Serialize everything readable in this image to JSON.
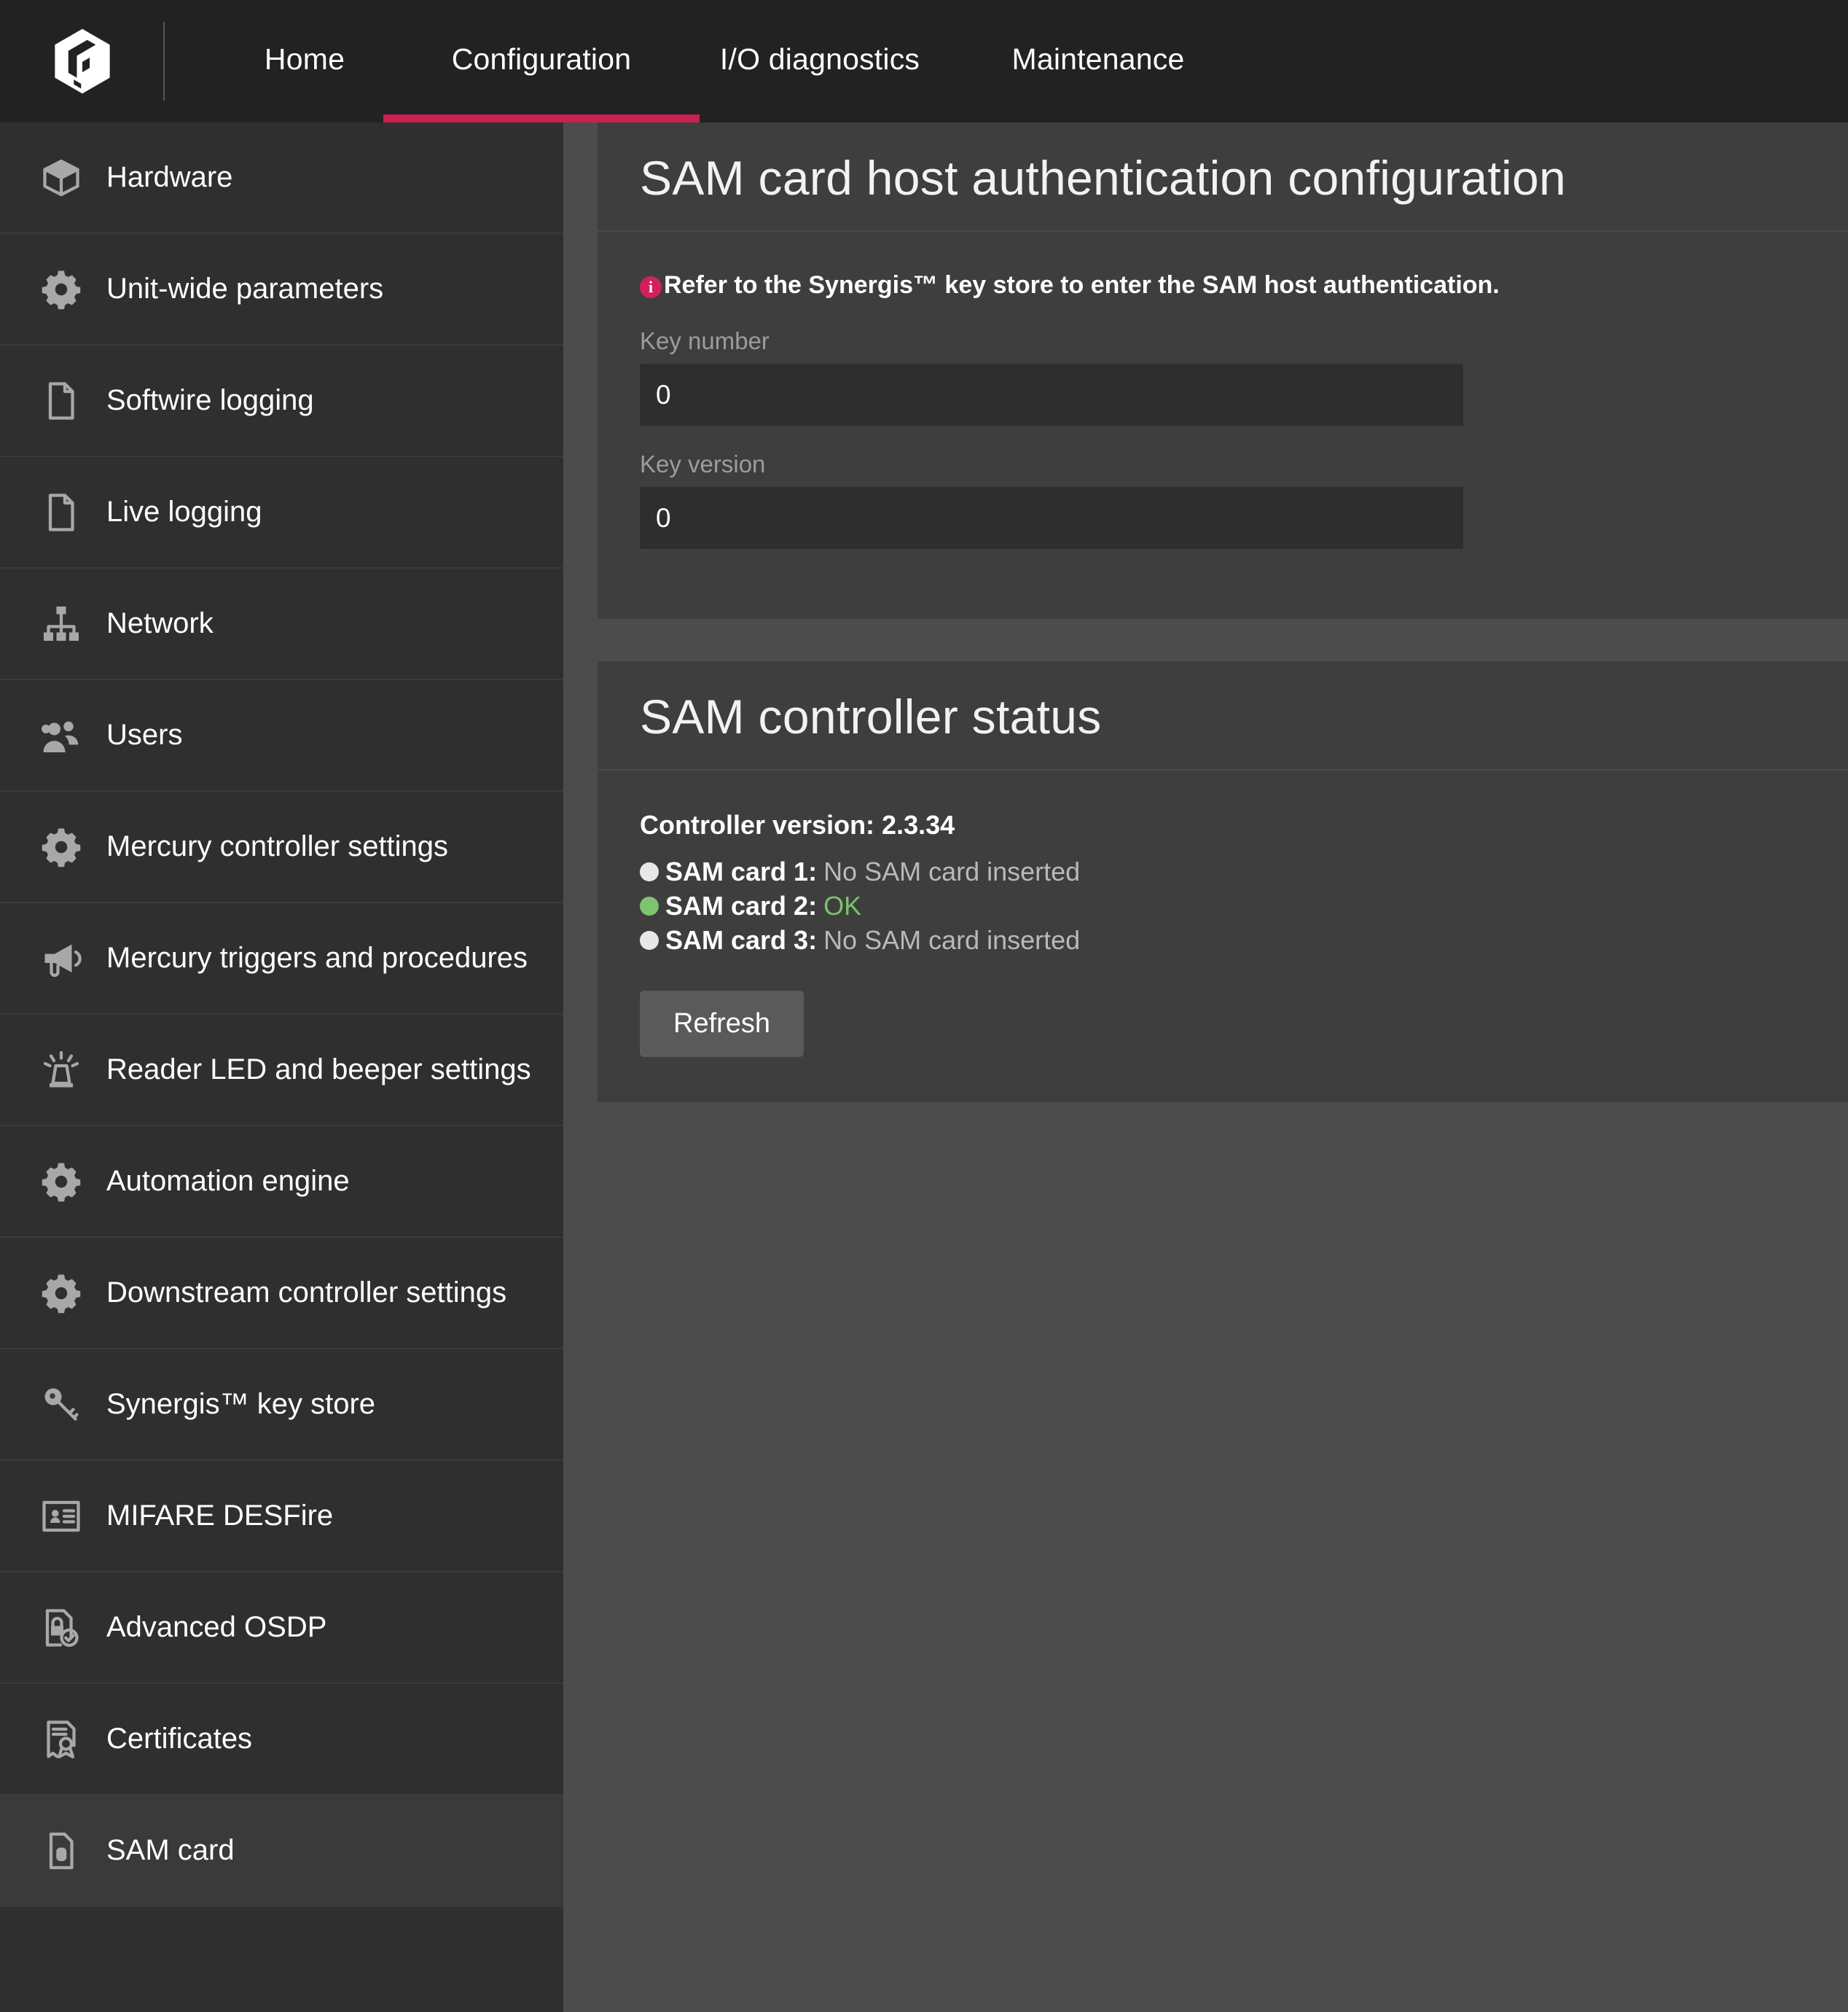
{
  "brand": {
    "logo_icon": "genetec-hexagon-logo"
  },
  "topnav": {
    "items": [
      {
        "label": "Home",
        "active": false
      },
      {
        "label": "Configuration",
        "active": true
      },
      {
        "label": "I/O diagnostics",
        "active": false
      },
      {
        "label": "Maintenance",
        "active": false
      }
    ],
    "accent_color": "#cb2052"
  },
  "sidebar": {
    "items": [
      {
        "label": "Hardware",
        "icon": "cube-icon",
        "selected": false
      },
      {
        "label": "Unit-wide parameters",
        "icon": "gear-icon",
        "selected": false
      },
      {
        "label": "Softwire logging",
        "icon": "document-icon",
        "selected": false
      },
      {
        "label": "Live logging",
        "icon": "document-icon",
        "selected": false
      },
      {
        "label": "Network",
        "icon": "network-tree-icon",
        "selected": false
      },
      {
        "label": "Users",
        "icon": "users-icon",
        "selected": false
      },
      {
        "label": "Mercury controller settings",
        "icon": "gear-icon",
        "selected": false
      },
      {
        "label": "Mercury triggers and procedures",
        "icon": "megaphone-icon",
        "selected": false
      },
      {
        "label": "Reader LED and beeper settings",
        "icon": "beacon-light-icon",
        "selected": false
      },
      {
        "label": "Automation engine",
        "icon": "gear-icon",
        "selected": false
      },
      {
        "label": "Downstream controller settings",
        "icon": "gear-icon",
        "selected": false
      },
      {
        "label": "Synergis™ key store",
        "icon": "key-icon",
        "selected": false
      },
      {
        "label": "MIFARE DESFire",
        "icon": "id-card-icon",
        "selected": false
      },
      {
        "label": "Advanced OSDP",
        "icon": "lock-check-document-icon",
        "selected": false
      },
      {
        "label": "Certificates",
        "icon": "certificate-icon",
        "selected": false
      },
      {
        "label": "SAM card",
        "icon": "sim-card-icon",
        "selected": true
      }
    ]
  },
  "auth_panel": {
    "title": "SAM card host authentication configuration",
    "info_icon": "info-circle-icon",
    "info_text": "Refer to the Synergis™ key store to enter the SAM host authentication.",
    "info_icon_color": "#d1215a",
    "fields": [
      {
        "label": "Key number",
        "value": "0",
        "placeholder": ""
      },
      {
        "label": "Key version",
        "value": "0",
        "placeholder": ""
      }
    ]
  },
  "status_panel": {
    "title": "SAM controller status",
    "controller_version_line": "Controller version: 2.3.34",
    "cards": [
      {
        "name": "SAM card 1:",
        "status": "No SAM card inserted",
        "dot_color": "#e8e8e8",
        "ok": false
      },
      {
        "name": "SAM card 2:",
        "status": "OK",
        "dot_color": "#7ec46f",
        "ok": true
      },
      {
        "name": "SAM card 3:",
        "status": "No SAM card inserted",
        "dot_color": "#e8e8e8",
        "ok": false
      }
    ],
    "refresh_label": "Refresh"
  }
}
